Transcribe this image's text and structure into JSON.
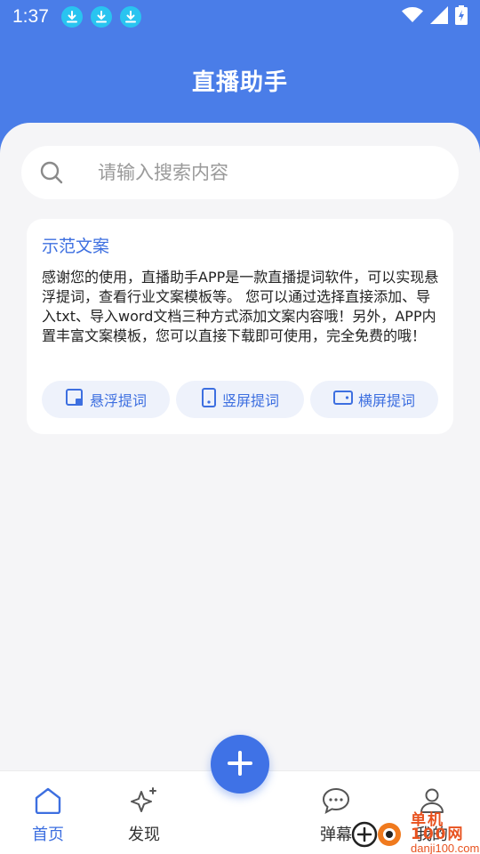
{
  "status_bar": {
    "time": "1:37",
    "download_icons": [
      "download-icon",
      "download-icon",
      "download-icon"
    ],
    "right_icons": [
      "wifi-icon",
      "signal-icon",
      "battery-charging-icon"
    ]
  },
  "header": {
    "title": "直播助手"
  },
  "search": {
    "placeholder": "请输入搜索内容",
    "value": ""
  },
  "sample_card": {
    "title": "示范文案",
    "description": "感谢您的使用，直播助手APP是一款直播提词软件，可以实现悬浮提词，查看行业文案模板等。 您可以通过选择直接添加、导入txt、导入word文档三种方式添加文案内容哦！另外，APP内置丰富文案模板，您可以直接下载即可使用，完全免费的哦！",
    "buttons": [
      {
        "label": "悬浮提词",
        "icon": "float-window-icon"
      },
      {
        "label": "竖屏提词",
        "icon": "portrait-screen-icon"
      },
      {
        "label": "横屏提词",
        "icon": "landscape-screen-icon"
      }
    ]
  },
  "tabbar": {
    "tabs": [
      {
        "label": "首页",
        "icon": "home-icon",
        "active": true
      },
      {
        "label": "发现",
        "icon": "sparkle-icon",
        "active": false
      },
      {
        "label": "弹幕",
        "icon": "chat-bubble-icon",
        "active": false
      },
      {
        "label": "我的",
        "icon": "user-icon",
        "active": false
      }
    ],
    "fab_icon": "plus-icon"
  },
  "watermark": {
    "line1": "单机100网",
    "line2": "danji100.com"
  },
  "colors": {
    "primary": "#4a7de8",
    "accent": "#3d6fe0",
    "background": "#f5f5f7"
  }
}
